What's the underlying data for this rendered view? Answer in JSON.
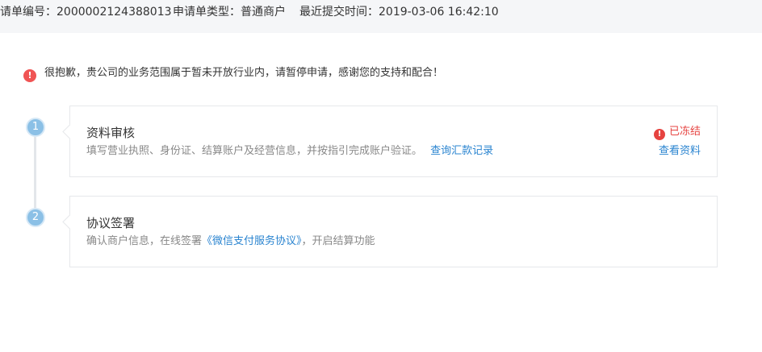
{
  "header": {
    "app_no_label": "请单编号：",
    "app_no_value": "2000002124388013",
    "type_label": "申请单类型：",
    "type_value": "普通商户",
    "time_label": "最近提交时间：",
    "time_value": "2019-03-06 16:42:10"
  },
  "alert": {
    "icon": "exclamation-icon",
    "text": "很抱歉，贵公司的业务范围属于暂未开放行业内，请暂停申请，感谢您的支持和配合！"
  },
  "steps": [
    {
      "number": "1",
      "title": "资料审核",
      "desc": "填写营业执照、身份证、结算账户及经营信息，并按指引完成账户验证。",
      "link": "查询汇款记录",
      "status": "已冻结",
      "view_link": "查看资料"
    },
    {
      "number": "2",
      "title": "协议签署",
      "desc_before": "确认商户信息，在线签署",
      "link": "《微信支付服务协议》",
      "desc_after": "，开启结算功能"
    }
  ],
  "colors": {
    "accent": "#2a84d0",
    "danger": "#e64340",
    "step": "#8bc0e6",
    "topbar_bg": "#f5f6f8"
  }
}
